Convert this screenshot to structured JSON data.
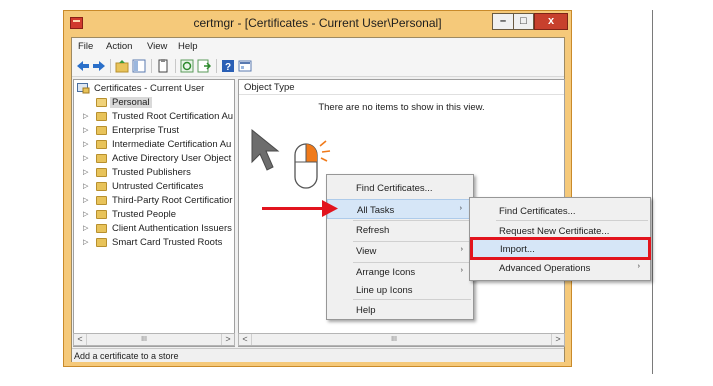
{
  "window": {
    "title": "certmgr - [Certificates - Current User\\Personal]",
    "min_glyph": "–",
    "max_glyph": "□",
    "close_glyph": "x"
  },
  "menu": [
    "File",
    "Action",
    "View",
    "Help"
  ],
  "toolbar_icons": [
    "back-arrow-icon",
    "forward-arrow-icon",
    "up-folder-icon",
    "show-hide-tree-icon",
    "copy-icon",
    "refresh-icon",
    "export-list-icon",
    "help-icon",
    "properties-icon"
  ],
  "tree": {
    "root": "Certificates - Current User",
    "items": [
      "Personal",
      "Trusted Root Certification Au",
      "Enterprise Trust",
      "Intermediate Certification Au",
      "Active Directory User Object",
      "Trusted Publishers",
      "Untrusted Certificates",
      "Third-Party Root Certificatior",
      "Trusted People",
      "Client Authentication Issuers",
      "Smart Card Trusted Roots"
    ]
  },
  "right_pane": {
    "column": "Object Type",
    "empty_message": "There are no items to show in this view."
  },
  "scrollbar": {
    "left": "<",
    "right": ">",
    "thumb": "III"
  },
  "status": "Add a certificate to a store",
  "context_menu": {
    "items": [
      "Find Certificates...",
      "All Tasks",
      "Refresh",
      "View",
      "Arrange Icons",
      "Line up Icons",
      "Help"
    ],
    "submenu_arrow": "›"
  },
  "submenu": {
    "items": [
      "Find Certificates...",
      "Request New Certificate...",
      "Import...",
      "Advanced Operations"
    ]
  },
  "colors": {
    "annotation": "#e2141e",
    "titlebar": "#f5c97a",
    "highlight": "#d6e6f7"
  }
}
